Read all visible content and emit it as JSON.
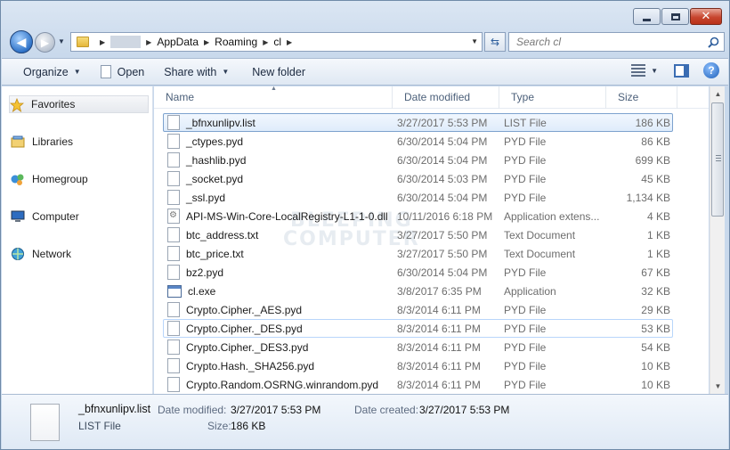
{
  "window": {
    "colors": {
      "frame": "#c9d9ec",
      "selection_border": "#7da2ce",
      "close_button": "#c7452e"
    }
  },
  "address_bar": {
    "crumbs": [
      "AppData",
      "Roaming",
      "cl"
    ]
  },
  "search": {
    "placeholder": "Search cl"
  },
  "toolbar": {
    "organize": "Organize",
    "open": "Open",
    "share_with": "Share with",
    "new_folder": "New folder"
  },
  "navigation": [
    {
      "label": "Favorites",
      "icon": "star-icon"
    },
    {
      "label": "Libraries",
      "icon": "libraries-icon"
    },
    {
      "label": "Homegroup",
      "icon": "homegroup-icon"
    },
    {
      "label": "Computer",
      "icon": "computer-icon"
    },
    {
      "label": "Network",
      "icon": "network-icon"
    }
  ],
  "columns": [
    "Name",
    "Date modified",
    "Type",
    "Size"
  ],
  "files": [
    {
      "name": "_bfnxunlipv.list",
      "date": "3/27/2017 5:53 PM",
      "type": "LIST File",
      "size": "186 KB",
      "icon": "document-icon",
      "state": "selected"
    },
    {
      "name": "_ctypes.pyd",
      "date": "6/30/2014 5:04 PM",
      "type": "PYD File",
      "size": "86 KB",
      "icon": "document-icon"
    },
    {
      "name": "_hashlib.pyd",
      "date": "6/30/2014 5:04 PM",
      "type": "PYD File",
      "size": "699 KB",
      "icon": "document-icon"
    },
    {
      "name": "_socket.pyd",
      "date": "6/30/2014 5:03 PM",
      "type": "PYD File",
      "size": "45 KB",
      "icon": "document-icon"
    },
    {
      "name": "_ssl.pyd",
      "date": "6/30/2014 5:04 PM",
      "type": "PYD File",
      "size": "1,134 KB",
      "icon": "document-icon"
    },
    {
      "name": "API-MS-Win-Core-LocalRegistry-L1-1-0.dll",
      "date": "10/11/2016 6:18 PM",
      "type": "Application extens...",
      "size": "4 KB",
      "icon": "dll-icon"
    },
    {
      "name": "btc_address.txt",
      "date": "3/27/2017 5:50 PM",
      "type": "Text Document",
      "size": "1 KB",
      "icon": "document-icon"
    },
    {
      "name": "btc_price.txt",
      "date": "3/27/2017 5:50 PM",
      "type": "Text Document",
      "size": "1 KB",
      "icon": "document-icon"
    },
    {
      "name": "bz2.pyd",
      "date": "6/30/2014 5:04 PM",
      "type": "PYD File",
      "size": "67 KB",
      "icon": "document-icon"
    },
    {
      "name": "cl.exe",
      "date": "3/8/2017 6:35 PM",
      "type": "Application",
      "size": "32 KB",
      "icon": "application-icon"
    },
    {
      "name": "Crypto.Cipher._AES.pyd",
      "date": "8/3/2014 6:11 PM",
      "type": "PYD File",
      "size": "29 KB",
      "icon": "document-icon"
    },
    {
      "name": "Crypto.Cipher._DES.pyd",
      "date": "8/3/2014 6:11 PM",
      "type": "PYD File",
      "size": "53 KB",
      "icon": "document-icon",
      "state": "hover"
    },
    {
      "name": "Crypto.Cipher._DES3.pyd",
      "date": "8/3/2014 6:11 PM",
      "type": "PYD File",
      "size": "54 KB",
      "icon": "document-icon"
    },
    {
      "name": "Crypto.Hash._SHA256.pyd",
      "date": "8/3/2014 6:11 PM",
      "type": "PYD File",
      "size": "10 KB",
      "icon": "document-icon"
    },
    {
      "name": "Crypto.Random.OSRNG.winrandom.pyd",
      "date": "8/3/2014 6:11 PM",
      "type": "PYD File",
      "size": "10 KB",
      "icon": "document-icon"
    }
  ],
  "watermark": [
    "BLEEPING",
    "COMPUTER"
  ],
  "details": {
    "name": "_bfnxunlipv.list",
    "type": "LIST File",
    "date_modified_label": "Date modified:",
    "date_modified": "3/27/2017 5:53 PM",
    "date_created_label": "Date created:",
    "date_created": "3/27/2017 5:53 PM",
    "size_label": "Size:",
    "size": "186 KB"
  }
}
